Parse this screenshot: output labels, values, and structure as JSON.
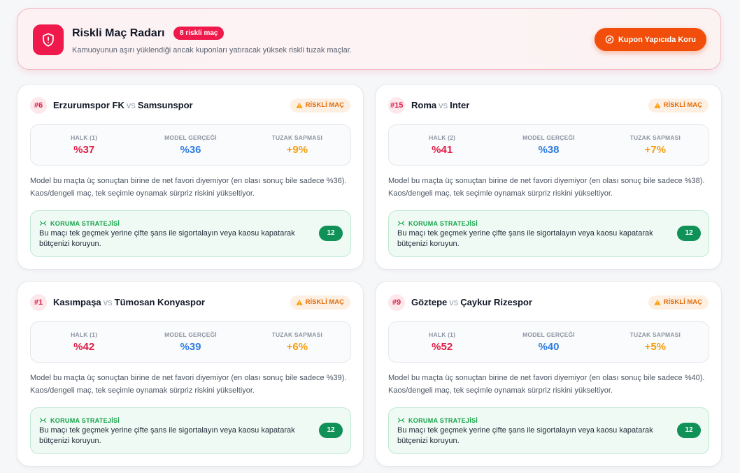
{
  "header": {
    "title": "Riskli Maç Radarı",
    "badge": "8 riskli maç",
    "subtitle": "Kamuoyunun aşırı yüklendiği ancak kuponları yatıracak yüksek riskli tuzak maçlar.",
    "cta_label": "Kupon Yapıcıda Koru",
    "accent_color": "#ef1a4b",
    "cta_color": "#f14e0b"
  },
  "labels": {
    "risk_badge": "RİSKLİ MAÇ",
    "model": "MODEL GERÇEĞİ",
    "trap": "TUZAK SAPMASI",
    "strategy_title": "KORUMA STRATEJİSİ",
    "vs": "vs"
  },
  "cards": [
    {
      "rank": "#6",
      "home": "Erzurumspor FK",
      "away": "Samsunspor",
      "crowd_label": "HALK (1)",
      "crowd": "%37",
      "model": "%36",
      "trap": "+9%",
      "desc": "Model bu maçta üç sonuçtan birine de net favori diyemiyor (en olası sonuç bile sadece %36). Kaos/dengeli maç, tek seçimle oynamak sürpriz riskini yükseltiyor.",
      "strategy": "Bu maçı tek geçmek yerine çifte şans ile sigortalayın veya kaosu kapatarak bütçenizi koruyun.",
      "count": "12"
    },
    {
      "rank": "#15",
      "home": "Roma",
      "away": "Inter",
      "crowd_label": "HALK (2)",
      "crowd": "%41",
      "model": "%38",
      "trap": "+7%",
      "desc": "Model bu maçta üç sonuçtan birine de net favori diyemiyor (en olası sonuç bile sadece %38). Kaos/dengeli maç, tek seçimle oynamak sürpriz riskini yükseltiyor.",
      "strategy": "Bu maçı tek geçmek yerine çifte şans ile sigortalayın veya kaosu kapatarak bütçenizi koruyun.",
      "count": "12"
    },
    {
      "rank": "#1",
      "home": "Kasımpaşa",
      "away": "Tümosan Konyaspor",
      "crowd_label": "HALK (1)",
      "crowd": "%42",
      "model": "%39",
      "trap": "+6%",
      "desc": "Model bu maçta üç sonuçtan birine de net favori diyemiyor (en olası sonuç bile sadece %39). Kaos/dengeli maç, tek seçimle oynamak sürpriz riskini yükseltiyor.",
      "strategy": "Bu maçı tek geçmek yerine çifte şans ile sigortalayın veya kaosu kapatarak bütçenizi koruyun.",
      "count": "12"
    },
    {
      "rank": "#9",
      "home": "Göztepe",
      "away": "Çaykur Rizespor",
      "crowd_label": "HALK (1)",
      "crowd": "%52",
      "model": "%40",
      "trap": "+5%",
      "desc": "Model bu maçta üç sonuçtan birine de net favori diyemiyor (en olası sonuç bile sadece %40). Kaos/dengeli maç, tek seçimle oynamak sürpriz riskini yükseltiyor.",
      "strategy": "Bu maçı tek geçmek yerine çifte şans ile sigortalayın veya kaosu kapatarak bütçenizi koruyun.",
      "count": "12"
    }
  ]
}
